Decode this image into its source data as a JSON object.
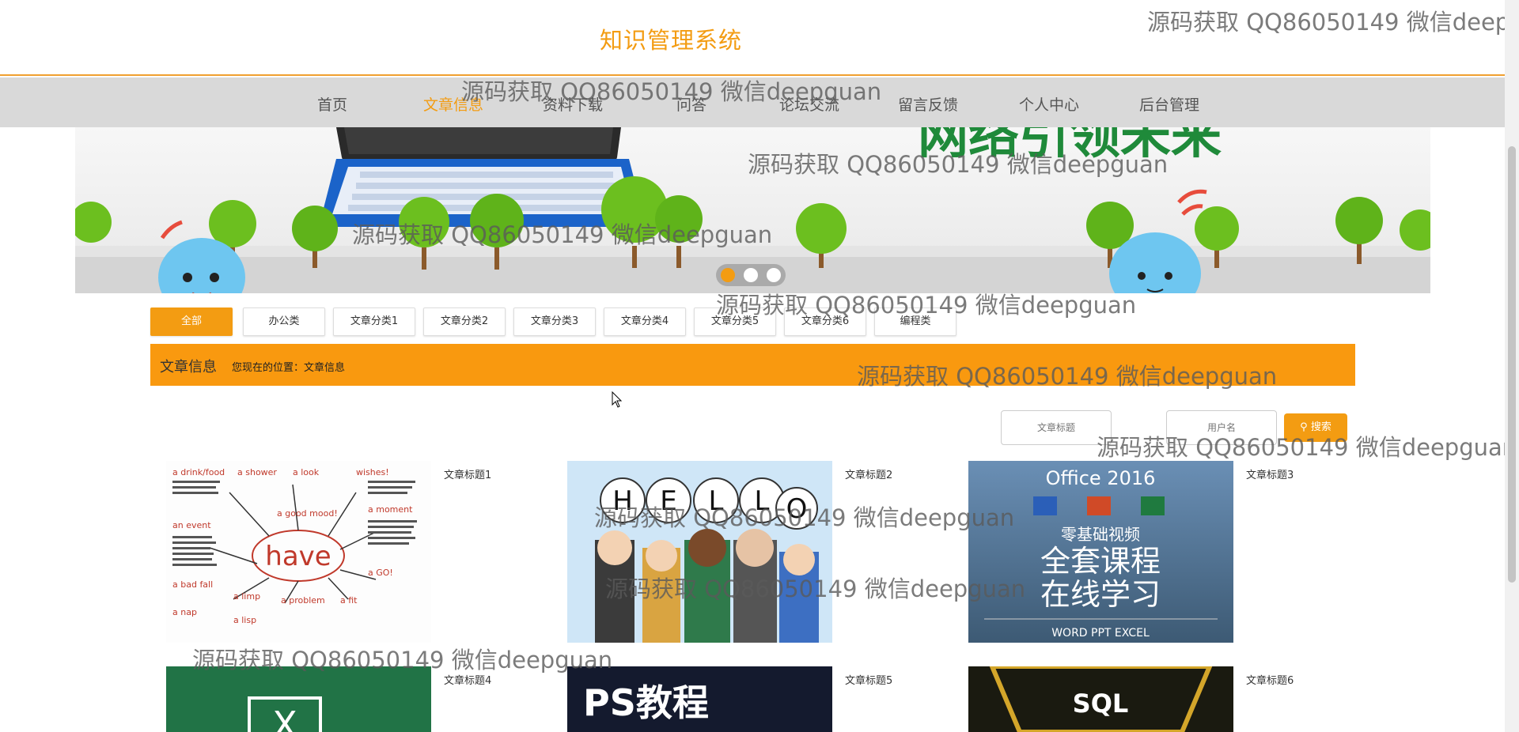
{
  "site_title": "知识管理系统",
  "nav": [
    {
      "label": "首页",
      "active": false
    },
    {
      "label": "文章信息",
      "active": true
    },
    {
      "label": "资料下载",
      "active": false
    },
    {
      "label": "问答",
      "active": false
    },
    {
      "label": "论坛交流",
      "active": false
    },
    {
      "label": "留言反馈",
      "active": false
    },
    {
      "label": "个人中心",
      "active": false
    },
    {
      "label": "后台管理",
      "active": false
    }
  ],
  "banner": {
    "headline": "网络引领未来",
    "active_slide": 1,
    "slide_count": 3
  },
  "categories": [
    "全部",
    "办公类",
    "文章分类1",
    "文章分类2",
    "文章分类3",
    "文章分类4",
    "文章分类5",
    "文章分类6",
    "编程类"
  ],
  "breadcrumb": {
    "title": "文章信息",
    "location": "您现在的位置：文章信息"
  },
  "search": {
    "title_placeholder": "文章标题",
    "user_placeholder": "用户名",
    "button_label": "搜索"
  },
  "articles": [
    {
      "title": "文章标题1",
      "image_text": "have"
    },
    {
      "title": "文章标题2",
      "image_text": "HELLO"
    },
    {
      "title": "文章标题3",
      "image_text": "Office 2016",
      "image_sub1": "零基础视频",
      "image_sub2": "全套课程",
      "image_sub3": "在线学习",
      "image_sub4": "WORD   PPT   EXCEL"
    },
    {
      "title": "文章标题4",
      "image_text": "X"
    },
    {
      "title": "文章标题5",
      "image_text": "PS教程"
    },
    {
      "title": "文章标题6",
      "image_text": "SQL"
    }
  ],
  "watermark": "源码获取 QQ86050149 微信deepguan",
  "watermark_clipped": "源码获取 QQ86050149 微信deepg",
  "colors": {
    "accent": "#f39c12",
    "bar": "#f9990f",
    "nav_bg": "#d9d9d9"
  }
}
